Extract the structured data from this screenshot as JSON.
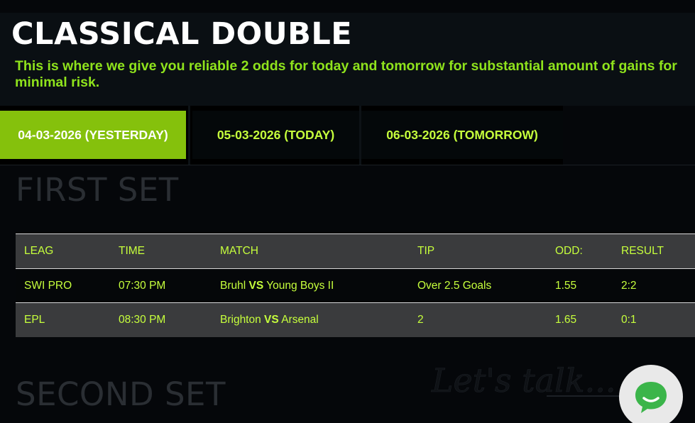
{
  "header": {
    "title": "CLASSICAL DOUBLE",
    "subtitle": "This is where we give you reliable 2 odds for today and tomorrow for substantial amount of gains for minimal risk."
  },
  "tabs": [
    {
      "label": "04-03-2026 (YESTERDAY)",
      "active": true
    },
    {
      "label": "05-03-2026 (TODAY)",
      "active": false
    },
    {
      "label": "06-03-2026 (TOMORROW)",
      "active": false
    }
  ],
  "sections": {
    "first_title": "FIRST SET",
    "second_title": "SECOND SET"
  },
  "table": {
    "headers": [
      "LEAG",
      "TIME",
      "MATCH",
      "TIP",
      "ODD:",
      "RESULT"
    ],
    "vs_label": "VS",
    "rows": [
      {
        "leag": "SWI PRO",
        "time": "07:30 PM",
        "home": "Bruhl",
        "away": "Young Boys II",
        "tip": "Over 2.5 Goals",
        "odd": "1.55",
        "result": "2:2"
      },
      {
        "leag": "EPL",
        "time": "08:30 PM",
        "home": "Brighton",
        "away": "Arsenal",
        "tip": "2",
        "odd": "1.65",
        "result": "0:1"
      }
    ]
  },
  "widget": {
    "tagline": "Let's talk...",
    "icon": "chat-bubble-icon"
  },
  "colors": {
    "accent": "#85c10c",
    "accent_text": "#c6ff3c",
    "subtitle_green": "#8fe31c",
    "background": "#05070a",
    "table_header_bg": "#3a3b3d",
    "chat_icon": "#3bb54a"
  }
}
